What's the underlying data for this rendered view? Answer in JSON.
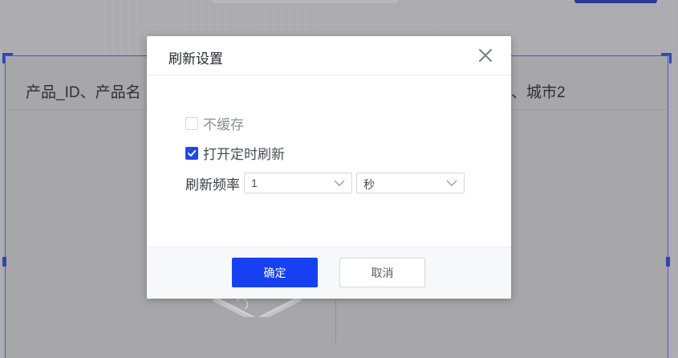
{
  "background": {
    "header_text_left": "产品_ID、产品名",
    "header_text_right": "、城市2"
  },
  "dialog": {
    "title": "刷新设置",
    "no_cache": {
      "label": "不缓存",
      "checked": false,
      "disabled": true
    },
    "timer_refresh": {
      "label": "打开定时刷新",
      "checked": true
    },
    "frequency": {
      "label": "刷新频率",
      "value": "1",
      "unit": "秒"
    },
    "confirm_label": "确定",
    "cancel_label": "取消"
  },
  "colors": {
    "accent": "#1640f0",
    "selection_border": "#2a44c7"
  },
  "icons": {
    "close": "close-icon",
    "check": "check-icon",
    "dropdown": "chevron-down-icon"
  }
}
